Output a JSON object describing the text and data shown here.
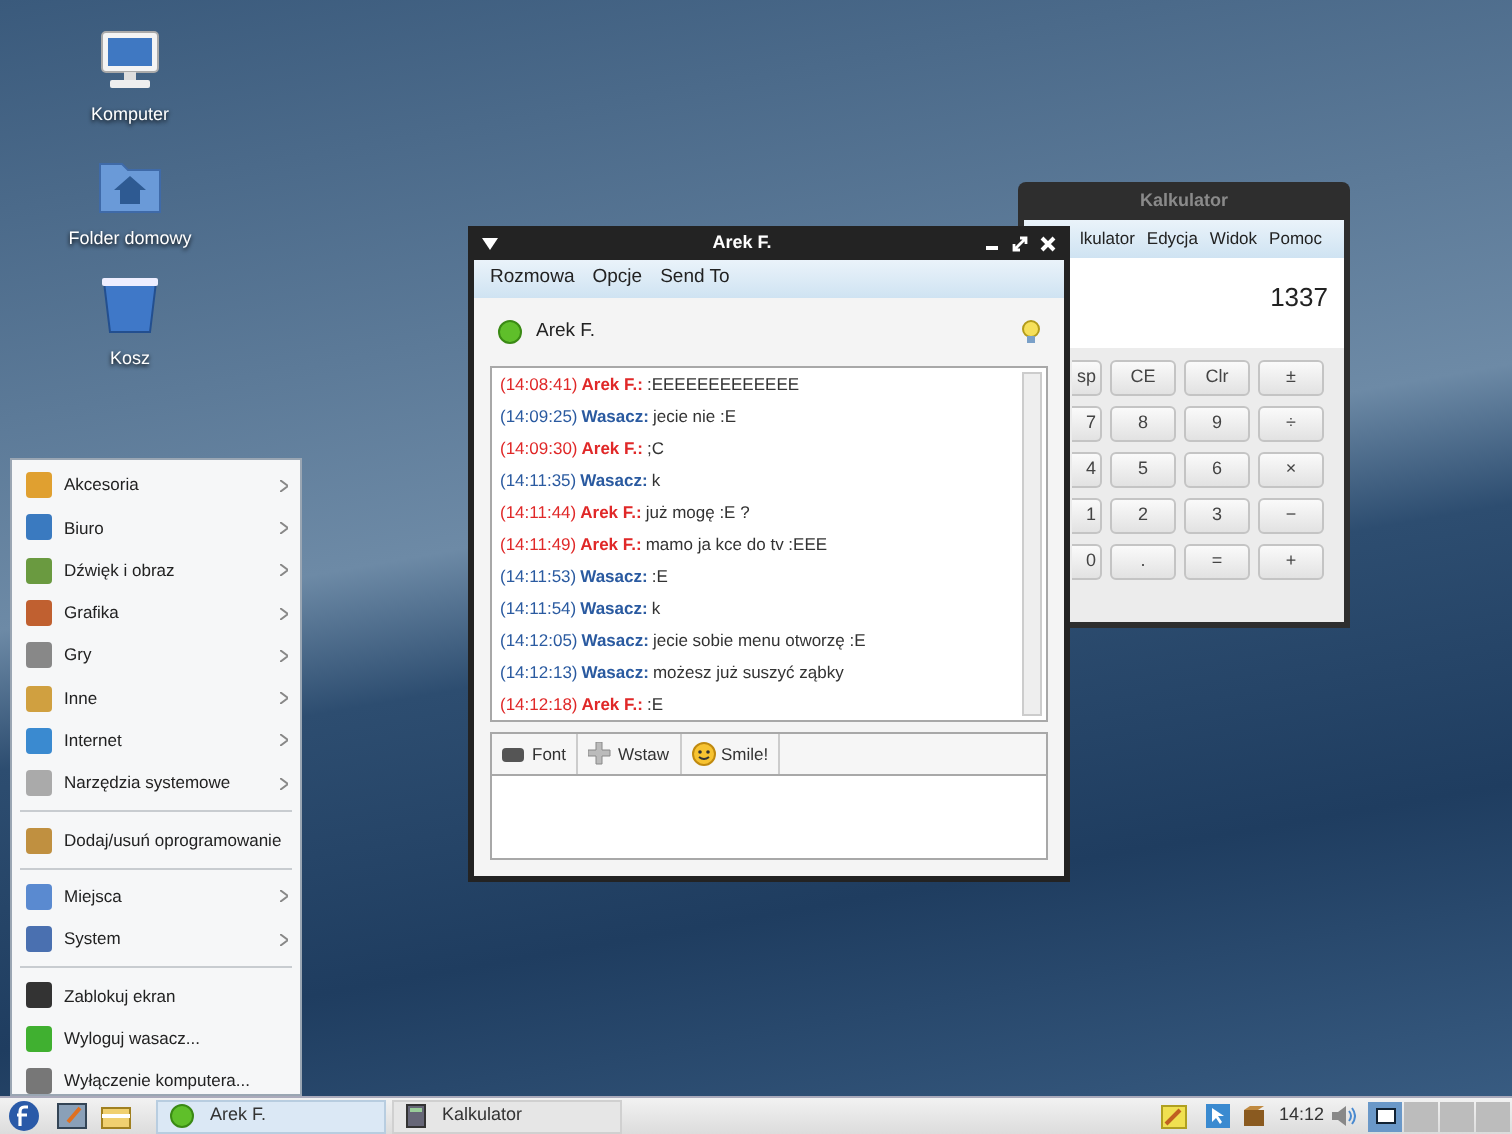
{
  "desktop_icons": [
    {
      "label": "Komputer",
      "kind": "computer"
    },
    {
      "label": "Folder domowy",
      "kind": "home"
    },
    {
      "label": "Kosz",
      "kind": "trash"
    }
  ],
  "calculator": {
    "title": "Kalkulator",
    "menu": [
      "lkulator",
      "Edycja",
      "Widok",
      "Pomoc"
    ],
    "display": "1337",
    "keys": [
      [
        "sp",
        "CE",
        "Clr",
        "±"
      ],
      [
        "7",
        "8",
        "9",
        "÷"
      ],
      [
        "4",
        "5",
        "6",
        "×"
      ],
      [
        "1",
        "2",
        "3",
        "−"
      ],
      [
        "0",
        ".",
        "=",
        "+"
      ]
    ]
  },
  "chat": {
    "title": "Arek F.",
    "menu": [
      "Rozmowa",
      "Opcje",
      "Send To"
    ],
    "contact": "Arek F.",
    "messages": [
      {
        "time": "(14:08:41)",
        "sender": "Arek F.:",
        "text": ":EEEEEEEEEEEEE",
        "kind": "peer"
      },
      {
        "time": "(14:09:25)",
        "sender": "Wasacz:",
        "text": "jecie nie :E",
        "kind": "self"
      },
      {
        "time": "(14:09:30)",
        "sender": "Arek F.:",
        "text": ";C",
        "kind": "peer"
      },
      {
        "time": "(14:11:35)",
        "sender": "Wasacz:",
        "text": "k",
        "kind": "self"
      },
      {
        "time": "(14:11:44)",
        "sender": "Arek F.:",
        "text": "już mogę :E ?",
        "kind": "peer"
      },
      {
        "time": "(14:11:49)",
        "sender": "Arek F.:",
        "text": "mamo ja kce do tv :EEE",
        "kind": "peer"
      },
      {
        "time": "(14:11:53)",
        "sender": "Wasacz:",
        "text": ":E",
        "kind": "self"
      },
      {
        "time": "(14:11:54)",
        "sender": "Wasacz:",
        "text": "k",
        "kind": "self"
      },
      {
        "time": "(14:12:05)",
        "sender": "Wasacz:",
        "text": "jecie sobie menu otworzę :E",
        "kind": "self"
      },
      {
        "time": "(14:12:13)",
        "sender": "Wasacz:",
        "text": "możesz już suszyć ząbky",
        "kind": "self"
      },
      {
        "time": "(14:12:18)",
        "sender": "Arek F.:",
        "text": ":E",
        "kind": "peer"
      }
    ],
    "toolbar": [
      "Font",
      "Wstaw",
      "Smile!"
    ]
  },
  "start_menu": [
    [
      {
        "label": "Akcesoria",
        "submenu": true
      },
      {
        "label": "Biuro",
        "submenu": true
      },
      {
        "label": "Dźwięk i obraz",
        "submenu": true
      },
      {
        "label": "Grafika",
        "submenu": true
      },
      {
        "label": "Gry",
        "submenu": true
      },
      {
        "label": "Inne",
        "submenu": true
      },
      {
        "label": "Internet",
        "submenu": true
      },
      {
        "label": "Narzędzia systemowe",
        "submenu": true
      }
    ],
    [
      {
        "label": "Dodaj/usuń oprogramowanie",
        "submenu": false
      }
    ],
    [
      {
        "label": "Miejsca",
        "submenu": true
      },
      {
        "label": "System",
        "submenu": true
      }
    ],
    [
      {
        "label": "Zablokuj ekran",
        "submenu": false
      },
      {
        "label": "Wyloguj wasacz...",
        "submenu": false
      },
      {
        "label": "Wyłączenie komputera...",
        "submenu": false
      }
    ]
  ],
  "taskbar": {
    "tasks": [
      {
        "label": "Arek F.",
        "selected": true,
        "kind": "chat"
      },
      {
        "label": "Kalkulator",
        "selected": false,
        "kind": "calc"
      }
    ],
    "clock": "14:12",
    "workspaces": [
      {
        "selected": true
      },
      {
        "selected": false
      },
      {
        "selected": false
      },
      {
        "selected": false
      }
    ]
  }
}
